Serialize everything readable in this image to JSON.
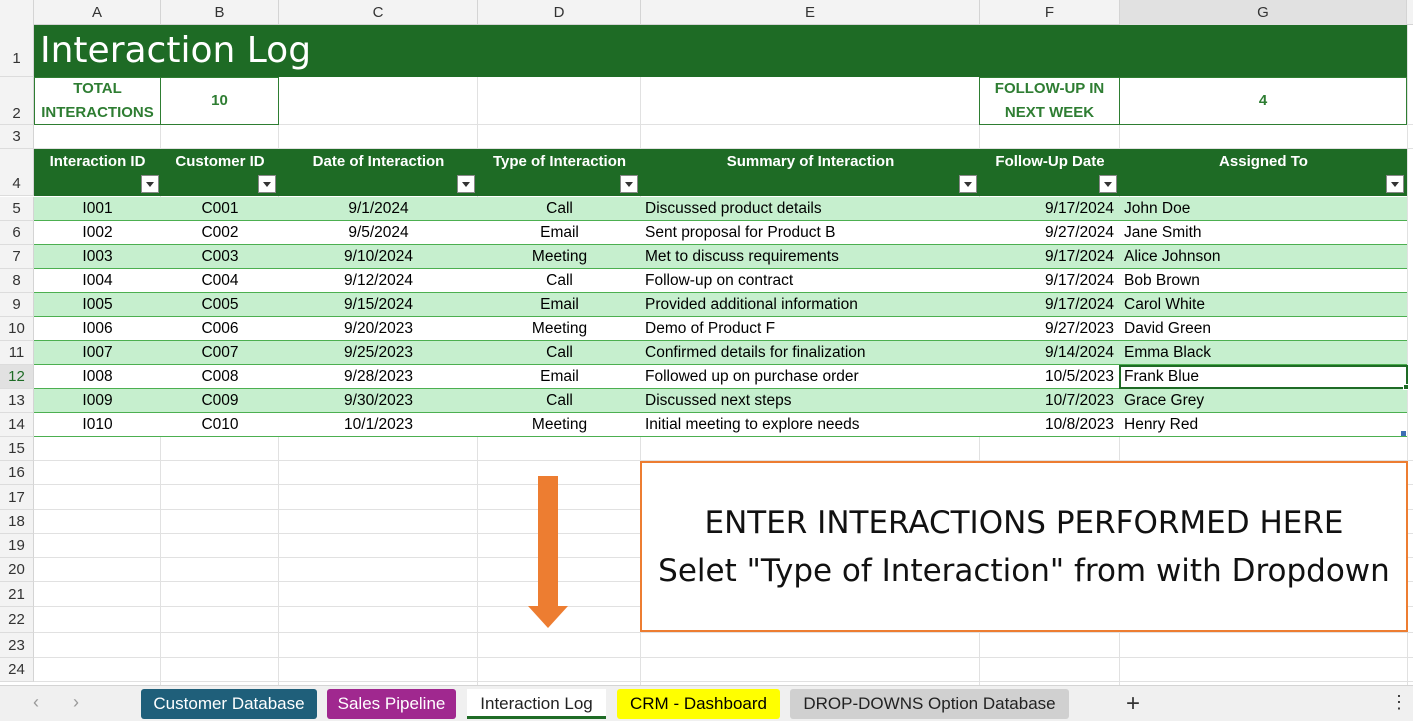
{
  "columns": [
    "A",
    "B",
    "C",
    "D",
    "E",
    "F",
    "G"
  ],
  "rows": [
    "1",
    "2",
    "3",
    "4",
    "5",
    "6",
    "7",
    "8",
    "9",
    "10",
    "11",
    "12",
    "13",
    "14",
    "15",
    "16",
    "17",
    "18",
    "19",
    "20",
    "21",
    "22",
    "23",
    "24"
  ],
  "title": "Interaction Log",
  "kpi": {
    "total_label_1": "TOTAL",
    "total_label_2": "INTERACTIONS",
    "total_value": "10",
    "followup_label_1": "FOLLOW-UP IN",
    "followup_label_2": "NEXT WEEK",
    "followup_value": "4"
  },
  "table": {
    "headers": [
      "Interaction ID",
      "Customer ID",
      "Date of Interaction",
      "Type of Interaction",
      "Summary of Interaction",
      "Follow-Up Date",
      "Assigned To"
    ],
    "rows": [
      [
        "I001",
        "C001",
        "9/1/2024",
        "Call",
        "Discussed product details",
        "9/17/2024",
        "John Doe"
      ],
      [
        "I002",
        "C002",
        "9/5/2024",
        "Email",
        "Sent proposal for Product B",
        "9/27/2024",
        "Jane Smith"
      ],
      [
        "I003",
        "C003",
        "9/10/2024",
        "Meeting",
        "Met to discuss requirements",
        "9/17/2024",
        "Alice Johnson"
      ],
      [
        "I004",
        "C004",
        "9/12/2024",
        "Call",
        "Follow-up on contract",
        "9/17/2024",
        "Bob Brown"
      ],
      [
        "I005",
        "C005",
        "9/15/2024",
        "Email",
        "Provided additional information",
        "9/17/2024",
        "Carol White"
      ],
      [
        "I006",
        "C006",
        "9/20/2023",
        "Meeting",
        "Demo of Product F",
        "9/27/2023",
        "David Green"
      ],
      [
        "I007",
        "C007",
        "9/25/2023",
        "Call",
        "Confirmed details for finalization",
        "9/14/2024",
        "Emma Black"
      ],
      [
        "I008",
        "C008",
        "9/28/2023",
        "Email",
        "Followed up on purchase order",
        "10/5/2023",
        "Frank Blue"
      ],
      [
        "I009",
        "C009",
        "9/30/2023",
        "Call",
        "Discussed next steps",
        "10/7/2023",
        "Grace Grey"
      ],
      [
        "I010",
        "C010",
        "10/1/2023",
        "Meeting",
        "Initial meeting to explore needs",
        "10/8/2023",
        "Henry Red"
      ]
    ]
  },
  "note": {
    "line1": "ENTER INTERACTIONS PERFORMED HERE",
    "line2": "Selet \"Type of Interaction\" from with Dropdown"
  },
  "sheet_tabs": [
    {
      "label": "Customer Database",
      "bg": "#1f5f7a",
      "fg": "#ffffff"
    },
    {
      "label": "Sales Pipeline",
      "bg": "#a0288f",
      "fg": "#ffffff"
    },
    {
      "label": "Interaction Log",
      "bg": "#ffffff",
      "fg": "#222222"
    },
    {
      "label": "CRM - Dashboard",
      "bg": "#ffff00",
      "fg": "#000000"
    },
    {
      "label": "DROP-DOWNS Option Database",
      "bg": "#d0d0d0",
      "fg": "#222222"
    }
  ],
  "colors": {
    "header_green": "#1e6b25",
    "band_green": "#c6efce",
    "accent_orange": "#ed7d31"
  },
  "icons": {
    "prev": "chevron-left-icon",
    "next": "chevron-right-icon",
    "add": "plus-icon",
    "more": "vertical-ellipsis-icon"
  }
}
